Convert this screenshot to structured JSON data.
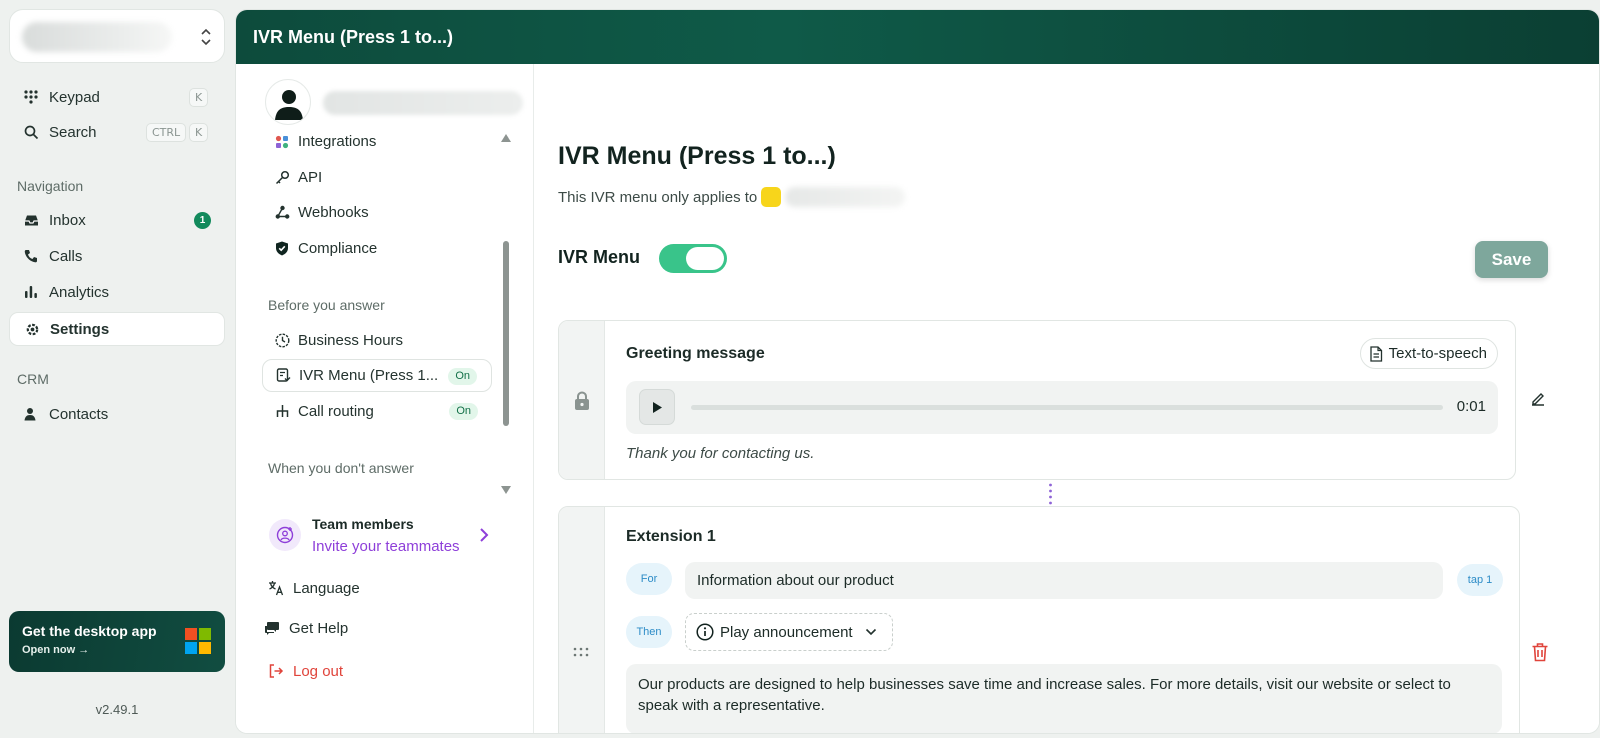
{
  "sidebar": {
    "keypad": {
      "label": "Keypad",
      "shortcut": "K"
    },
    "search": {
      "label": "Search",
      "shortcut_mod": "CTRL",
      "shortcut_key": "K"
    },
    "navigation_header": "Navigation",
    "inbox": {
      "label": "Inbox",
      "badge": "1"
    },
    "calls": {
      "label": "Calls"
    },
    "analytics": {
      "label": "Analytics"
    },
    "settings": {
      "label": "Settings"
    },
    "crm_header": "CRM",
    "contacts": {
      "label": "Contacts"
    },
    "desktop_app": {
      "title": "Get the desktop app",
      "cta": "Open now →"
    },
    "version": "v2.49.1"
  },
  "header": {
    "title": "IVR Menu (Press 1 to...)"
  },
  "settings_menu": {
    "integrations": "Integrations",
    "api": "API",
    "webhooks": "Webhooks",
    "compliance": "Compliance",
    "before_header": "Before you answer",
    "business_hours": "Business Hours",
    "ivr_menu": {
      "label": "IVR Menu (Press 1...",
      "status": "On"
    },
    "call_routing": {
      "label": "Call routing",
      "status": "On"
    },
    "when_header": "When you don't answer",
    "team": {
      "title": "Team members",
      "subtitle": "Invite your teammates"
    },
    "language": "Language",
    "help": "Get Help",
    "logout": "Log out"
  },
  "main": {
    "title": "IVR Menu (Press 1 to...)",
    "applies_text": "This IVR menu only applies to",
    "toggle_label": "IVR Menu",
    "toggle_on": true,
    "save_label": "Save",
    "greeting": {
      "label": "Greeting message",
      "tts_label": "Text-to-speech",
      "duration": "0:01",
      "message": "Thank you for contacting us."
    },
    "extension": {
      "label": "Extension 1",
      "for_chip": "For",
      "for_value": "Information about our product",
      "tap_chip": "tap 1",
      "then_chip": "Then",
      "action": "Play announcement",
      "announcement": "Our products are designed to help businesses save time and increase sales. For more details, visit our website or select to speak with a representative."
    }
  },
  "colors": {
    "brand": "#0f5a48",
    "toggle": "#39c48a",
    "accent_purple": "#8e3fd9",
    "danger": "#e0443b",
    "chip_blue": "#2d8cc7"
  }
}
